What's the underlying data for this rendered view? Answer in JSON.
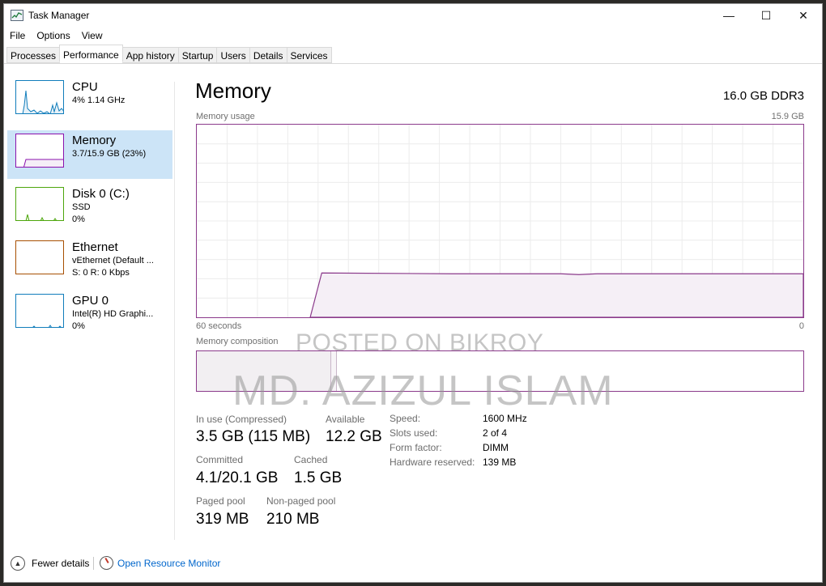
{
  "window": {
    "title": "Task Manager",
    "controls": {
      "minimize": "—",
      "maximize": "☐",
      "close": "✕"
    }
  },
  "menu": [
    "File",
    "Options",
    "View"
  ],
  "tabs": [
    "Processes",
    "Performance",
    "App history",
    "Startup",
    "Users",
    "Details",
    "Services"
  ],
  "active_tab": "Performance",
  "sidebar": [
    {
      "name": "CPU",
      "line1": "4% 1.14 GHz",
      "line2": "",
      "color": "#117dbb"
    },
    {
      "name": "Memory",
      "line1": "3.7/15.9 GB (23%)",
      "line2": "",
      "color": "#8b12ae"
    },
    {
      "name": "Disk 0 (C:)",
      "line1": "SSD",
      "line2": "0%",
      "color": "#4da60c"
    },
    {
      "name": "Ethernet",
      "line1": "vEthernet (Default ...",
      "line2": "S: 0 R: 0 Kbps",
      "color": "#a74f01"
    },
    {
      "name": "GPU 0",
      "line1": "Intel(R) HD Graphi...",
      "line2": "0%",
      "color": "#117dbb"
    }
  ],
  "main": {
    "title": "Memory",
    "spec": "16.0 GB DDR3",
    "usage_label": "Memory usage",
    "usage_max": "15.9 GB",
    "time_left": "60 seconds",
    "time_right": "0",
    "composition_label": "Memory composition",
    "graph_color": "#8b3a8b",
    "usage_fraction": 0.23,
    "composition": {
      "in_use": 0.22,
      "modified": 0.01,
      "standby": 0.08
    },
    "stats": {
      "in_use_label": "In use (Compressed)",
      "in_use_value": "3.5 GB (115 MB)",
      "available_label": "Available",
      "available_value": "12.2 GB",
      "committed_label": "Committed",
      "committed_value": "4.1/20.1 GB",
      "cached_label": "Cached",
      "cached_value": "1.5 GB",
      "paged_label": "Paged pool",
      "paged_value": "319 MB",
      "nonpaged_label": "Non-paged pool",
      "nonpaged_value": "210 MB"
    },
    "specs": [
      {
        "label": "Speed:",
        "value": "1600 MHz"
      },
      {
        "label": "Slots used:",
        "value": "2 of 4"
      },
      {
        "label": "Form factor:",
        "value": "DIMM"
      },
      {
        "label": "Hardware reserved:",
        "value": "139 MB"
      }
    ]
  },
  "watermark": {
    "line1": "POSTED ON BIKROY",
    "line2": "MD. AZIZUL ISLAM"
  },
  "footer": {
    "fewer": "Fewer details",
    "resource_monitor": "Open Resource Monitor"
  }
}
